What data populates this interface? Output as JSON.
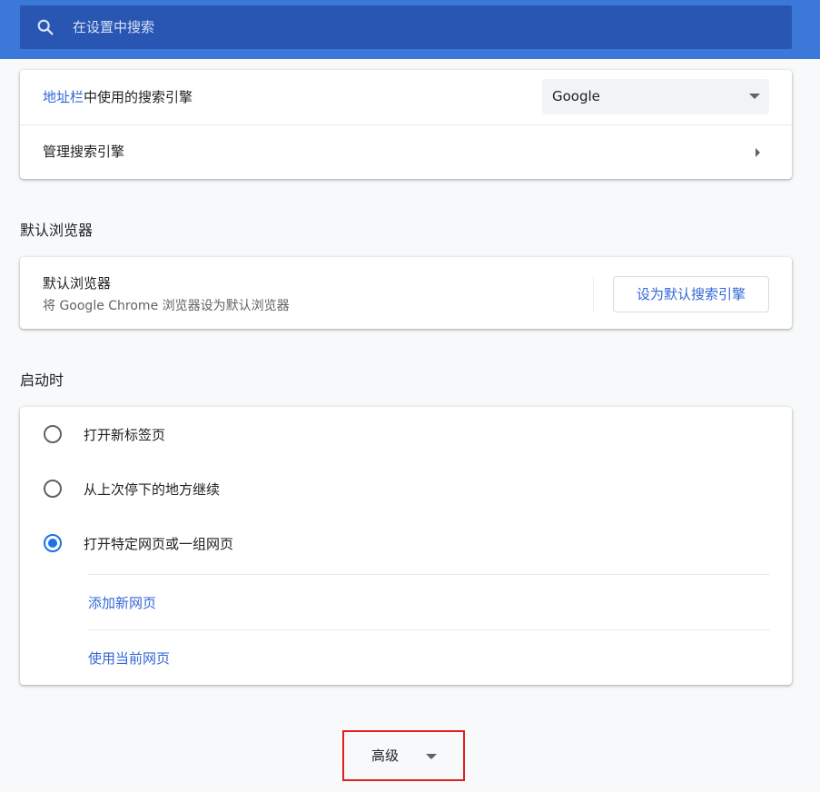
{
  "header": {
    "search_placeholder": "在设置中搜索"
  },
  "search_engine": {
    "row1": {
      "label_link": "地址栏",
      "label_rest": "中使用的搜索引擎",
      "selected": "Google"
    },
    "row2": {
      "label": "管理搜索引擎"
    }
  },
  "default_browser": {
    "section_title": "默认浏览器",
    "title": "默认浏览器",
    "subtitle": "将 Google Chrome 浏览器设为默认浏览器",
    "button_label": "设为默认搜索引擎"
  },
  "startup": {
    "section_title": "启动时",
    "options": [
      {
        "label": "打开新标签页",
        "checked": false
      },
      {
        "label": "从上次停下的地方继续",
        "checked": false
      },
      {
        "label": "打开特定网页或一组网页",
        "checked": true
      }
    ],
    "add_page": "添加新网页",
    "use_current": "使用当前网页"
  },
  "advanced": {
    "label": "高级"
  },
  "colors": {
    "header": "#3c78d8",
    "search_box": "#2a56b3",
    "link": "#3367d6",
    "radio_checked": "#1a73e8",
    "highlight_box": "#e01e1e"
  }
}
